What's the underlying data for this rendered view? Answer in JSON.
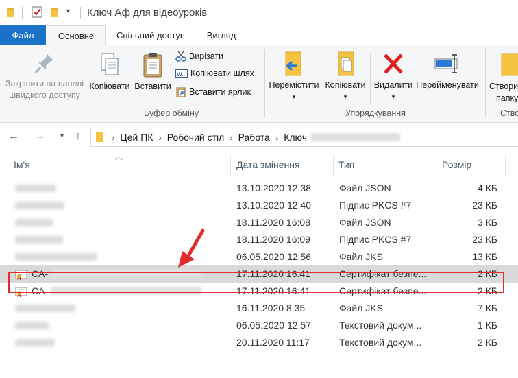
{
  "window": {
    "title": "Ключ Аф для відеоуроків"
  },
  "tabs": [
    {
      "label": "Файл"
    },
    {
      "label": "Основне"
    },
    {
      "label": "Спільний доступ"
    },
    {
      "label": "Вигляд"
    }
  ],
  "ribbon": {
    "pin": {
      "line1": "Закріпити на панелі",
      "line2": "швидкого доступу"
    },
    "copy": "Копіювати",
    "paste": "Вставити",
    "cut": "Вирізати",
    "copy_path": "Копіювати шлях",
    "paste_shortcut": "Вставити ярлик",
    "clipboard_group": "Буфер обміну",
    "move_to": "Перемістити",
    "copy_to": "Копіювати",
    "delete": "Видалити",
    "rename": "Перейменувати",
    "organize_group": "Упорядкування",
    "new_folder": {
      "line1": "Створи",
      "line2": "папку"
    },
    "new_group": "Ство"
  },
  "address": {
    "crumbs": [
      "Цей ПК",
      "Робочий стіл",
      "Работа",
      "Ключ"
    ]
  },
  "columns": {
    "name": "Ім'я",
    "date": "Дата змінення",
    "type": "Тип",
    "size": "Розмір"
  },
  "files": [
    {
      "date": "13.10.2020 12:38",
      "type": "Файл JSON",
      "size": "4 КБ",
      "icon": "blank-file-icon"
    },
    {
      "date": "13.10.2020 12:40",
      "type": "Підпис PKCS #7",
      "size": "23 КБ",
      "icon": "blank-file-icon"
    },
    {
      "date": "18.11.2020 16:08",
      "type": "Файл JSON",
      "size": "3 КБ",
      "icon": "blank-file-icon"
    },
    {
      "date": "18.11.2020 16:09",
      "type": "Підпис PKCS #7",
      "size": "23 КБ",
      "icon": "blank-file-icon"
    },
    {
      "date": "06.05.2020 12:56",
      "type": "Файл JKS",
      "size": "13 КБ",
      "icon": "blank-file-icon"
    },
    {
      "prefix": "CA-",
      "date": "17.11.2020 16:41",
      "type": "Сертифікат безпе...",
      "size": "2 КБ",
      "icon": "certificate-icon",
      "selected": true
    },
    {
      "prefix": "CA-",
      "date": "17.11.2020 16:41",
      "type": "Сертифікат безпе...",
      "size": "2 КБ",
      "icon": "certificate-icon"
    },
    {
      "date": "16.11.2020 8:35",
      "type": "Файл JKS",
      "size": "7 КБ",
      "icon": "blank-file-icon"
    },
    {
      "date": "06.05.2020 12:57",
      "type": "Текстовий докум...",
      "size": "1 КБ",
      "icon": "text-file-icon"
    },
    {
      "date": "20.11.2020 11:17",
      "type": "Текстовий докум...",
      "size": "2 КБ",
      "icon": "text-file-icon"
    }
  ],
  "colors": {
    "file_tab": "#1a73c7",
    "highlight": "#e52b2b",
    "selected_row": "#d9d9d9",
    "delete_red": "#e02020",
    "folder_yellow": "#f5c342"
  }
}
